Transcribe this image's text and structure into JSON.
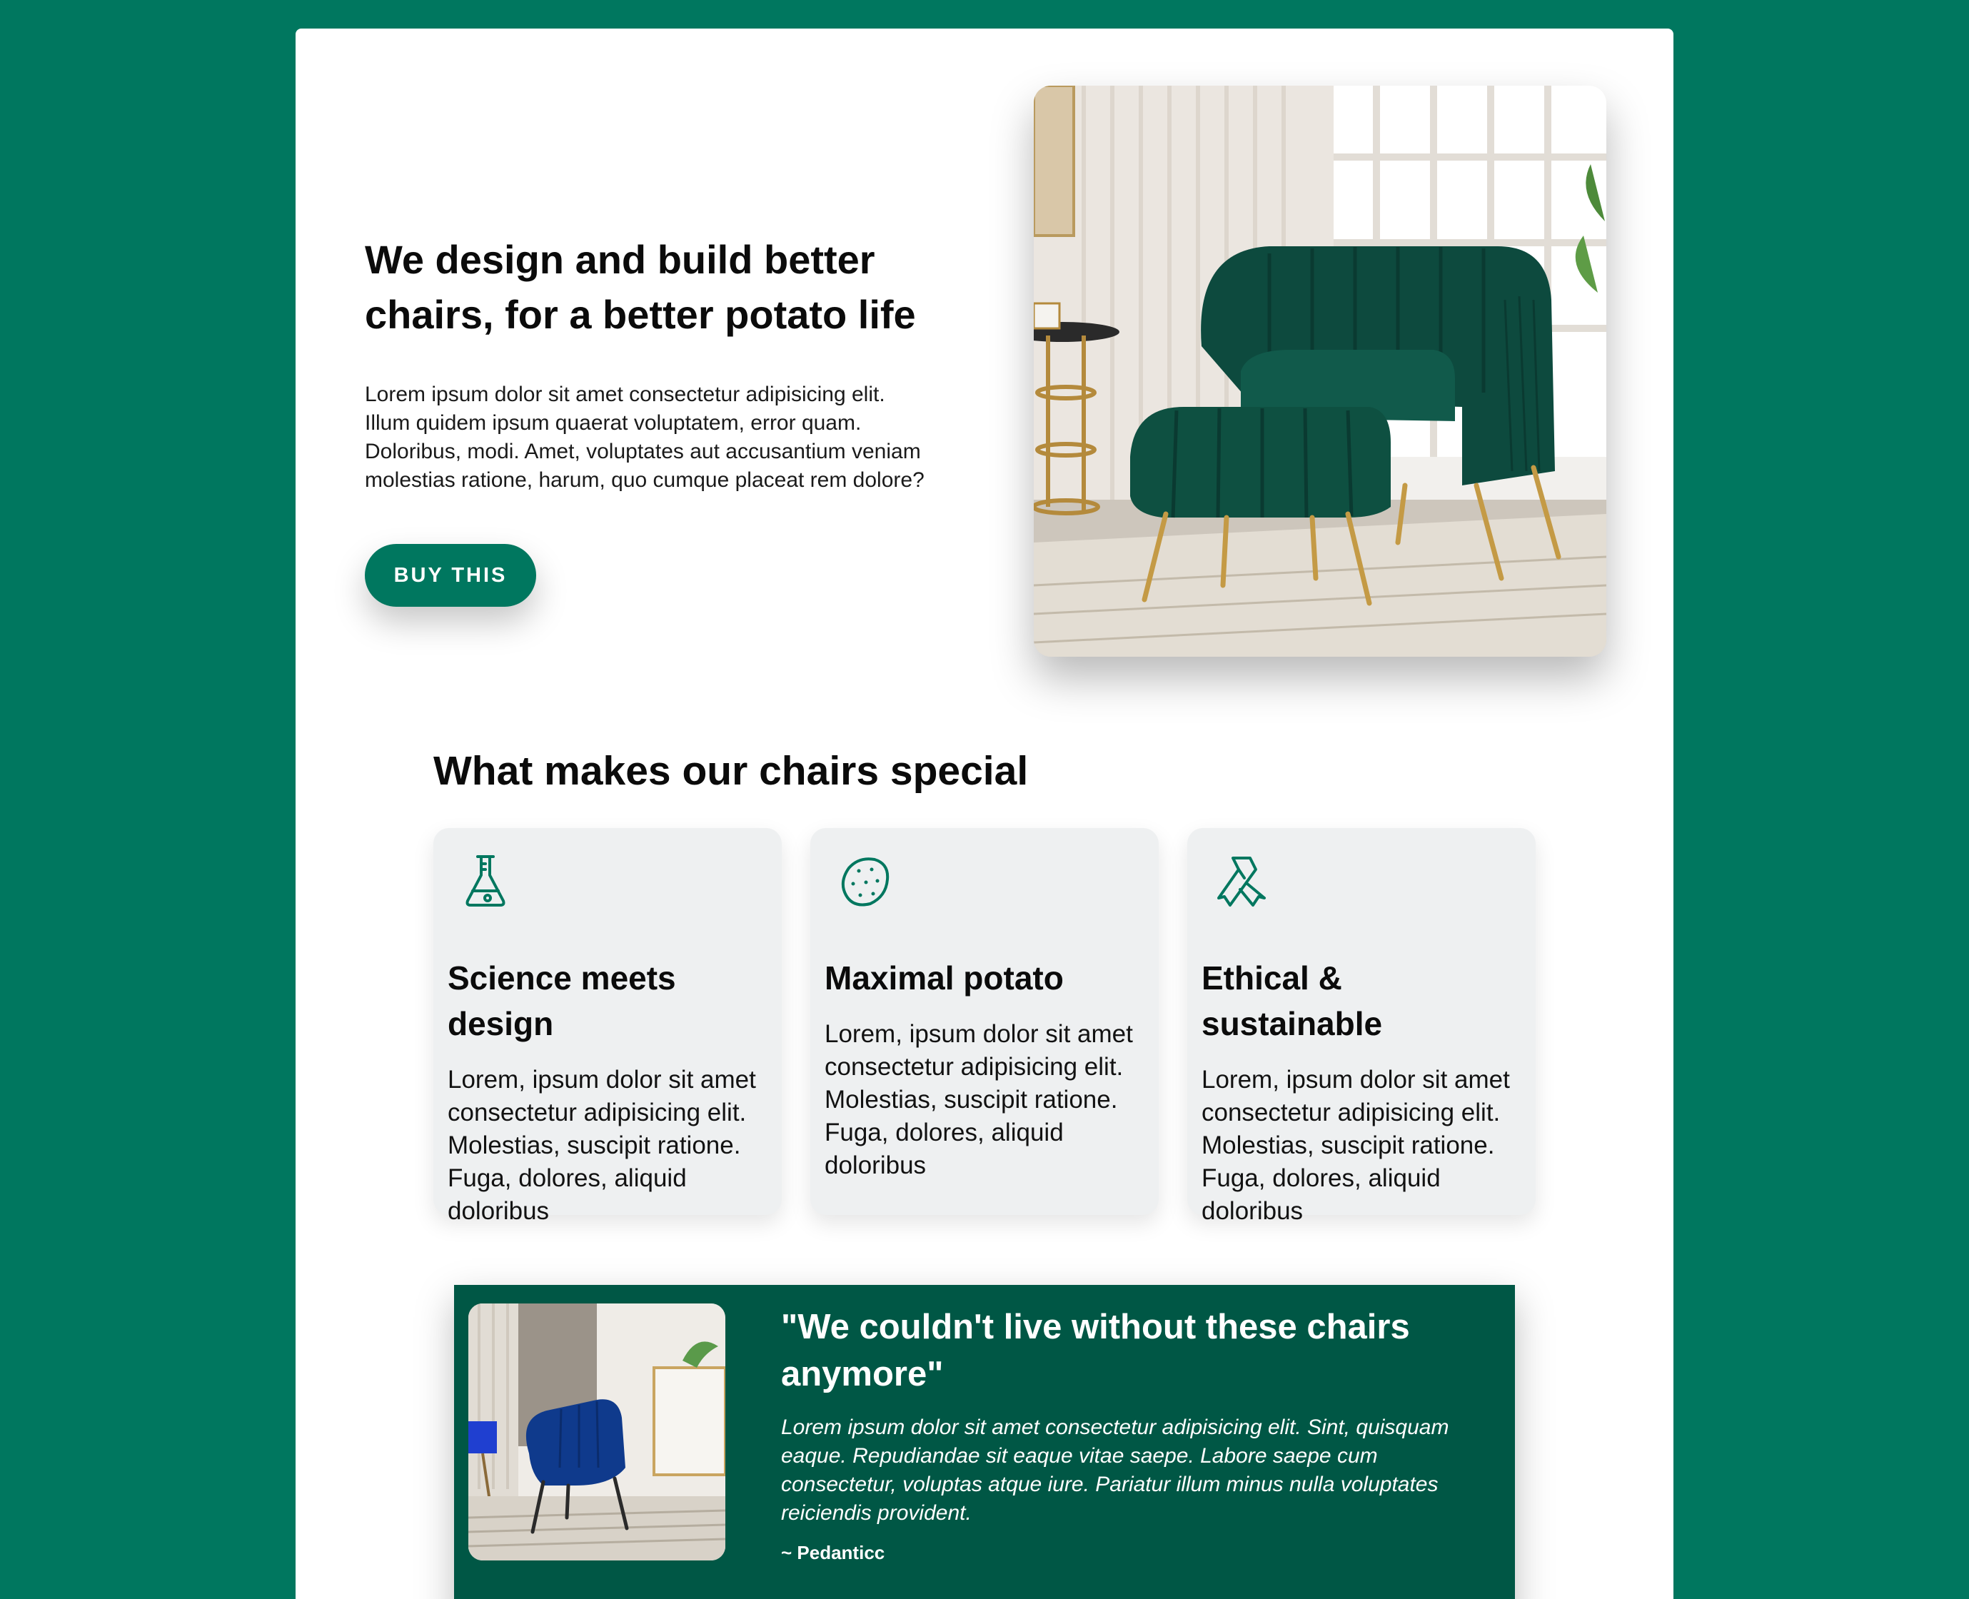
{
  "theme": {
    "background": "#00775f",
    "card_background": "#eef0f1",
    "testimonial_background": "#005745",
    "accent": "#00775f"
  },
  "hero": {
    "title": "We design and build better chairs, for a better potato life",
    "body": "Lorem ipsum dolor sit amet consectetur adipisicing elit. Illum quidem ipsum quaerat voluptatem, error quam. Doloribus, modi. Amet, voluptates aut accusantium veniam molestias ratione, harum, quo cumque placeat rem dolore?",
    "cta_label": "BUY THIS",
    "image_subject": "green-velvet-armchair-with-ottoman"
  },
  "features": {
    "title": "What makes our chairs special",
    "items": [
      {
        "icon": "flask-icon",
        "title": "Science meets design",
        "body": "Lorem, ipsum dolor sit amet consectetur adipisicing elit. Molestias, suscipit ratione. Fuga, dolores, aliquid doloribus"
      },
      {
        "icon": "potato-icon",
        "title": "Maximal potato",
        "body": "Lorem, ipsum dolor sit amet consectetur adipisicing elit. Molestias, suscipit ratione. Fuga, dolores, aliquid doloribus"
      },
      {
        "icon": "ribbon-icon",
        "title": "Ethical & sustainable",
        "body": "Lorem, ipsum dolor sit amet consectetur adipisicing elit. Molestias, suscipit ratione. Fuga, dolores, aliquid doloribus"
      }
    ]
  },
  "testimonial": {
    "quote": "\"We couldn't live without these chairs anymore\"",
    "body": "Lorem ipsum dolor sit amet consectetur adipisicing elit. Sint, quisquam eaque. Repudiandae sit eaque vitae saepe. Labore saepe cum consectetur, voluptas atque iure. Pariatur illum minus nulla voluptates reiciendis provident.",
    "author": "~ Pedanticc",
    "image_subject": "blue-velvet-armchair"
  }
}
